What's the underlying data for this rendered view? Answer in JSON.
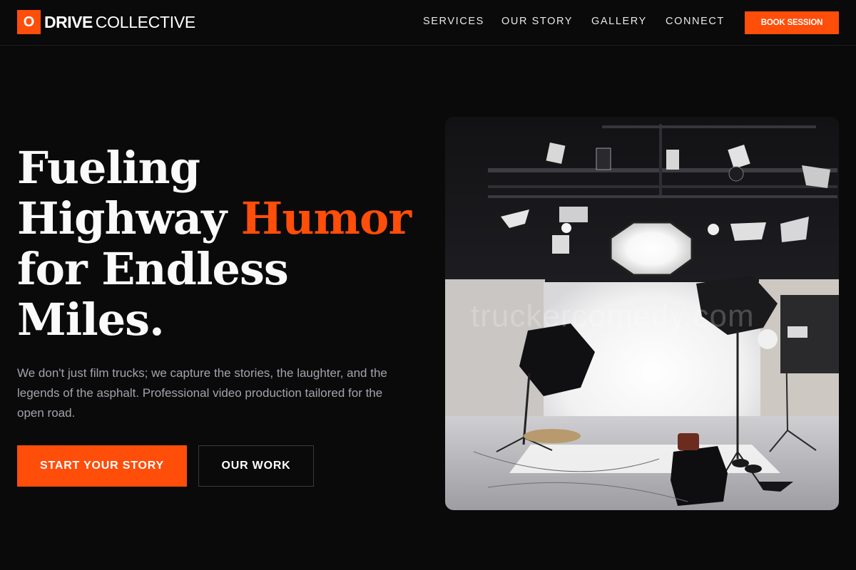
{
  "brand": {
    "mark": "O",
    "name_bold": "DRIVE",
    "name_light": "COLLECTIVE",
    "accent_color": "#ff4d0a"
  },
  "nav": {
    "items": [
      {
        "label": "SERVICES"
      },
      {
        "label": "OUR STORY"
      },
      {
        "label": "GALLERY"
      },
      {
        "label": "CONNECT"
      }
    ],
    "cta_label": "BOOK SESSION"
  },
  "hero": {
    "title_part1": "Fueling",
    "title_part2": "Highway",
    "title_accent": "Humor",
    "title_part3": "for Endless",
    "title_part4": "Miles.",
    "description": "We don't just film trucks; we capture the stories, the laughter, and the legends of the asphalt. Professional video production tailored for the open road.",
    "primary_button": "START YOUR STORY",
    "secondary_button": "OUR WORK"
  },
  "image": {
    "watermark": "truckercomedy.com",
    "subject": "photo-studio-with-softboxes-and-white-backdrop"
  }
}
